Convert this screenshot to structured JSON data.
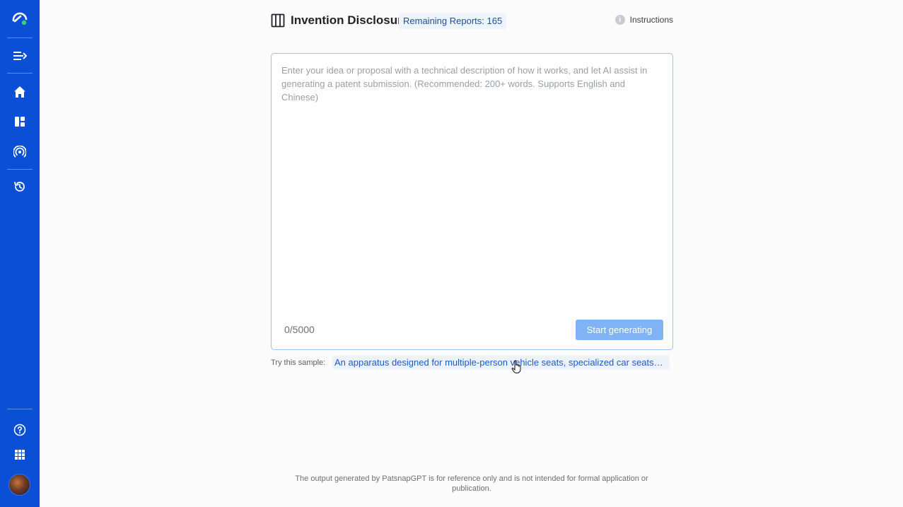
{
  "sidebar": {
    "items": [
      {
        "name": "logo",
        "icon": "patsnap-logo-icon"
      },
      {
        "name": "expand",
        "icon": "expand-menu-icon"
      },
      {
        "name": "home",
        "icon": "home-icon"
      },
      {
        "name": "workspace",
        "icon": "dashboard-icon"
      },
      {
        "name": "broadcast",
        "icon": "broadcast-icon"
      },
      {
        "name": "history",
        "icon": "history-icon"
      },
      {
        "name": "help",
        "icon": "help-icon"
      },
      {
        "name": "apps",
        "icon": "apps-grid-icon"
      },
      {
        "name": "avatar",
        "icon": "user-avatar"
      }
    ],
    "color": "#0a4fd6"
  },
  "header": {
    "title": "Invention Disclosure",
    "badge": "Remaining Reports: 165",
    "instructions_label": "Instructions"
  },
  "editor": {
    "placeholder": "Enter your idea or proposal with a technical description of how it works, and let AI assist in generating a patent submission. (Recommended: 200+ words. Supports English and Chinese)",
    "value": "",
    "counter": "0/5000",
    "start_label": "Start generating"
  },
  "sample": {
    "label": "Try this sample:",
    "text": "An apparatus designed for multiple-person vehicle seats, specialized car seats,..."
  },
  "footer": {
    "text": "The output generated by PatsnapGPT is for reference only and is not intended for formal application or publication."
  },
  "colors": {
    "accent": "#0a4fd6",
    "button_disabled": "#7fb3f5",
    "link": "#1a5cc4",
    "border": "#9cc3f5"
  }
}
